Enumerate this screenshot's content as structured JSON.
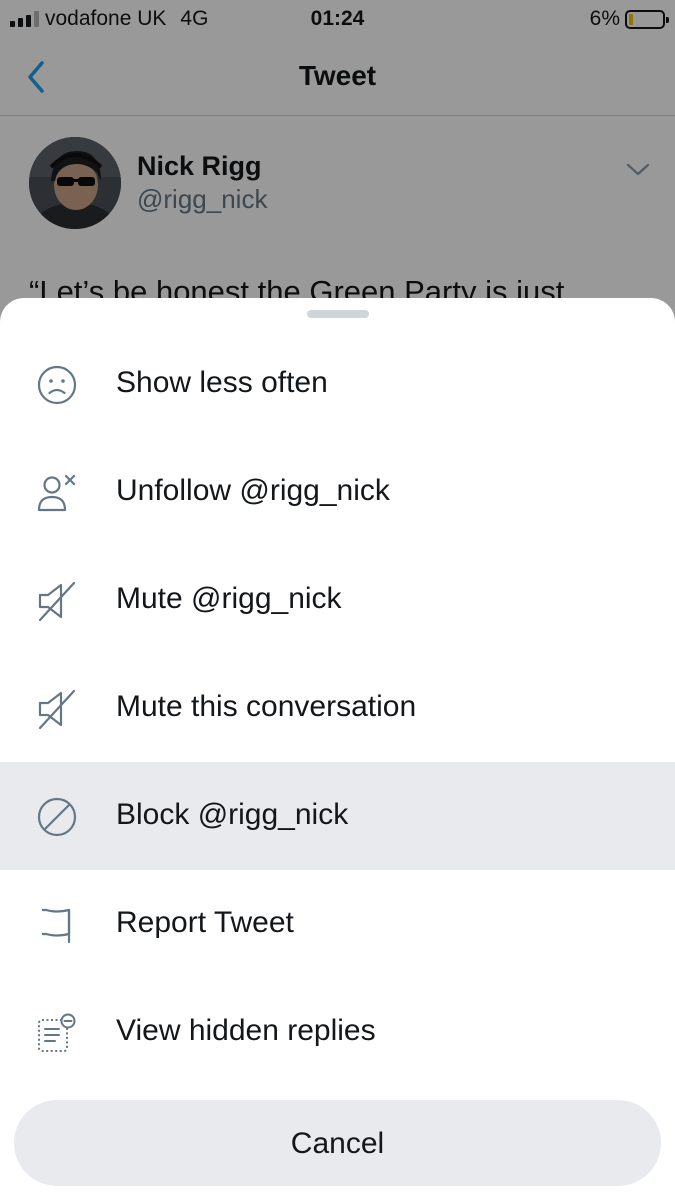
{
  "status_bar": {
    "carrier": "vodafone UK",
    "network": "4G",
    "time": "01:24",
    "battery_percent": "6%",
    "battery_level": 0.06,
    "signal_bars": 3,
    "signal_bars_max": 4
  },
  "nav": {
    "title": "Tweet",
    "back_icon": "chevron-left-icon"
  },
  "tweet": {
    "author_name": "Nick Rigg",
    "author_handle": "@rigg_nick",
    "text_partial": "“Let’s be honest the Green Party is just"
  },
  "sheet": {
    "items": [
      {
        "label": "Show less often",
        "icon": "sad-face-icon"
      },
      {
        "label": "Unfollow @rigg_nick",
        "icon": "unfollow-user-icon"
      },
      {
        "label": "Mute @rigg_nick",
        "icon": "mute-icon"
      },
      {
        "label": "Mute this conversation",
        "icon": "mute-icon"
      },
      {
        "label": "Block @rigg_nick",
        "icon": "block-icon",
        "highlighted": true
      },
      {
        "label": "Report Tweet",
        "icon": "flag-icon"
      },
      {
        "label": "View hidden replies",
        "icon": "hidden-replies-icon"
      }
    ],
    "cancel_label": "Cancel"
  },
  "colors": {
    "accent": "#1da1f2",
    "text": "#14171a",
    "secondary_text": "#657786",
    "highlight_bg": "#e8eaed",
    "battery_low": "#f5c400"
  }
}
